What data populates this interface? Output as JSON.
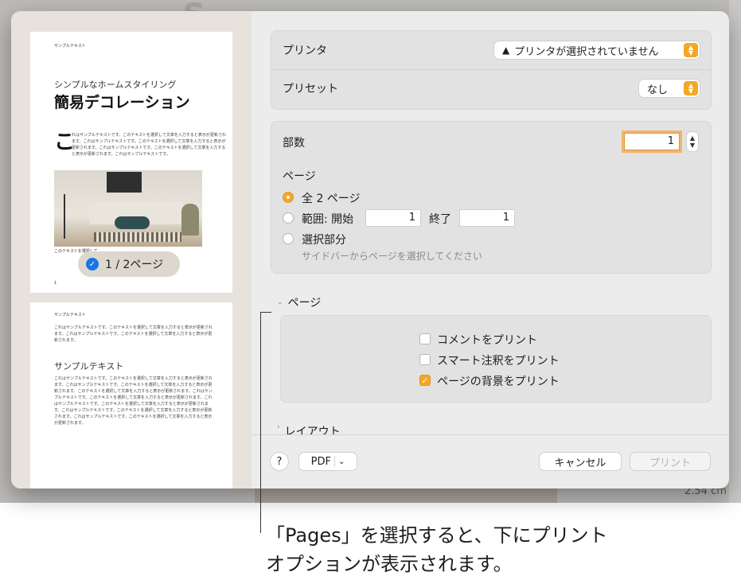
{
  "dialog": {
    "printer_label": "プリンタ",
    "printer_value": "プリンタが選択されていません",
    "preset_label": "プリセット",
    "preset_value": "なし",
    "copies_label": "部数",
    "copies_value": "1",
    "pages_label": "ページ",
    "pages_all": "全 2 ページ",
    "pages_range": "範囲: 開始",
    "range_from": "1",
    "range_to_label": "終了",
    "range_to": "1",
    "pages_selection": "選択部分",
    "selection_hint": "サイドバーからページを選択してください",
    "section_pages": "ページ",
    "opt_comments": "コメントをプリント",
    "opt_smart_annotations": "スマート注釈をプリント",
    "opt_background": "ページの背景をプリント",
    "section_layout": "レイアウト",
    "help": "?",
    "pdf": "PDF",
    "cancel": "キャンセル",
    "print": "プリント"
  },
  "options_state": {
    "comments": false,
    "smart_annotations": false,
    "background": true
  },
  "pages_choice": "all",
  "sidebar": {
    "page_badge": "1 / 2ページ",
    "thumb1": {
      "header": "サンプルテキスト",
      "subtitle": "シンプルなホームスタイリング",
      "title": "簡易デコレーション",
      "dropcap": "こ",
      "body": "れはサンプルテキストです。このテキストを選択して文章を入力すると表示が更新されます。これはサンプルテキストです。このテキストを選択して文章を入力すると表示が更新されます。これはサンプルテキストです。このテキストを選択して文章を入力すると表示が更新されます。これはサンプルテキストです。",
      "caption": "このテキストを選択して",
      "page_number": "1"
    },
    "thumb2": {
      "header": "サンプルテキスト",
      "para1": "これはサンプルテキストです。このテキストを選択して文章を入力すると表示が更新されます。これはサンプルテキストです。このテキストを選択して文章を入力すると表示が更新されます。",
      "heading": "サンプルテキスト",
      "para2": "これはサンプルテキストです。このテキストを選択して文章を入力すると表示が更新されます。これはサンプルテキストです。このテキストを選択して文章を入力すると表示が更新されます。このテキストを選択して文章を入力すると表示が更新されます。これはサンプルテキストです。このテキストを選択して文章を入力すると表示が更新されます。これはサンプルテキストです。このテキストを選択して文章を入力すると表示が更新されます。これはサンプルテキストです。このテキストを選択して文章を入力すると表示が更新されます。これはサンプルテキストです。このテキストを選択して文章を入力すると表示が更新されます。"
    }
  },
  "background": {
    "measure": "2.54 cm"
  },
  "callout": {
    "line1": "「Pages」を選択すると、下にプリント",
    "line2": "オプションが表示されます。"
  },
  "colors": {
    "accent": "#f5a623",
    "badge_check": "#1a73e8"
  },
  "icons": [
    "warning-icon",
    "chevron-updown-icon",
    "chevron-down-icon",
    "check-icon",
    "disclosure-triangle-icon",
    "stepper-icon"
  ]
}
